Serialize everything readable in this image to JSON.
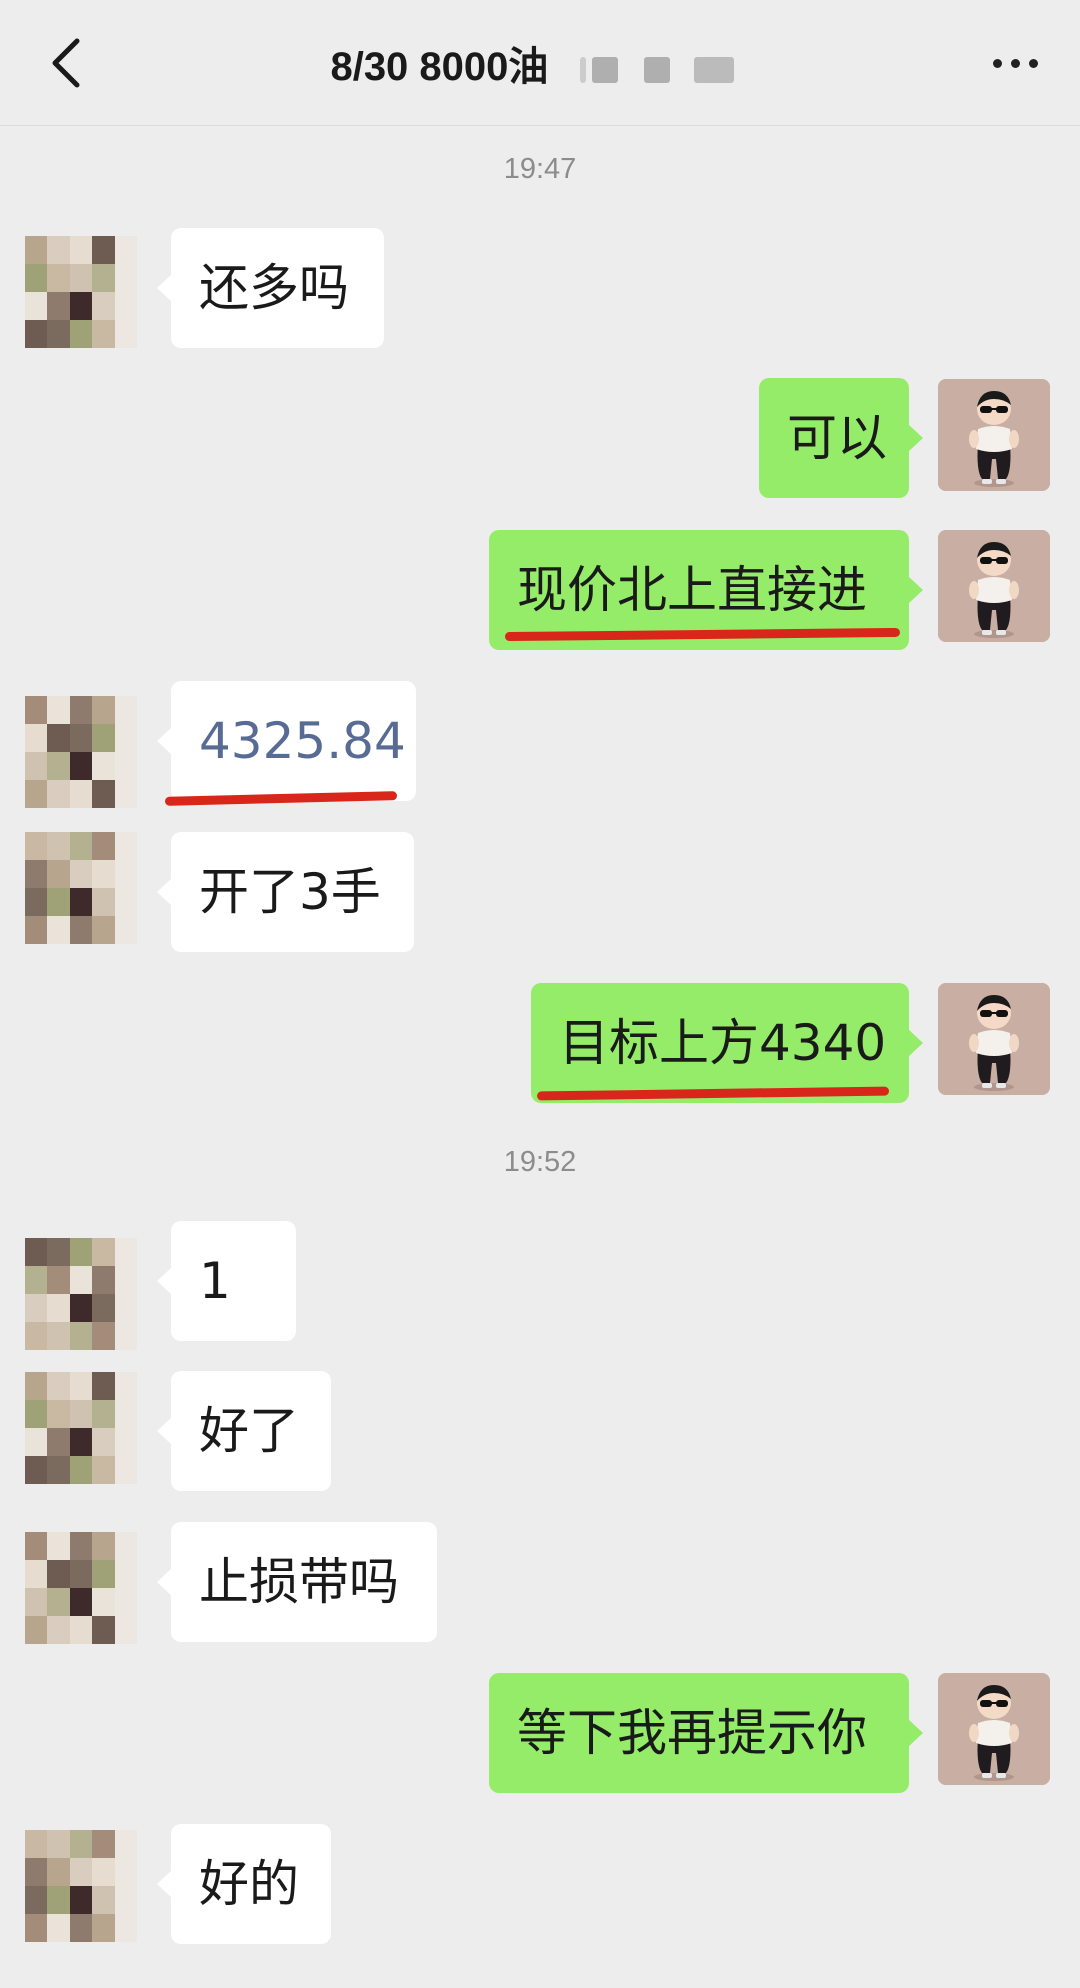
{
  "header": {
    "title": "8/30  8000油",
    "back_icon": "chevron-left-icon",
    "more_icon": "more-dots-icon"
  },
  "colors": {
    "sent_bubble": "#95ec69",
    "received_bubble": "#ffffff",
    "link_text": "#576b95",
    "underline_mark": "#d8261a",
    "background": "#ededed"
  },
  "timestamps": [
    "19:47",
    "19:52"
  ],
  "messages": [
    {
      "side": "left",
      "text": "还多吗"
    },
    {
      "side": "right",
      "text": "可以"
    },
    {
      "side": "right",
      "text": "现价北上直接进"
    },
    {
      "side": "left",
      "text": "4325.84"
    },
    {
      "side": "left",
      "text": "开了3手"
    },
    {
      "side": "right",
      "text": "目标上方4340"
    },
    {
      "side": "left",
      "text": "1"
    },
    {
      "side": "left",
      "text": "好了"
    },
    {
      "side": "left",
      "text": "止损带吗"
    },
    {
      "side": "right",
      "text": "等下我再提示你"
    },
    {
      "side": "left",
      "text": "好的"
    }
  ]
}
